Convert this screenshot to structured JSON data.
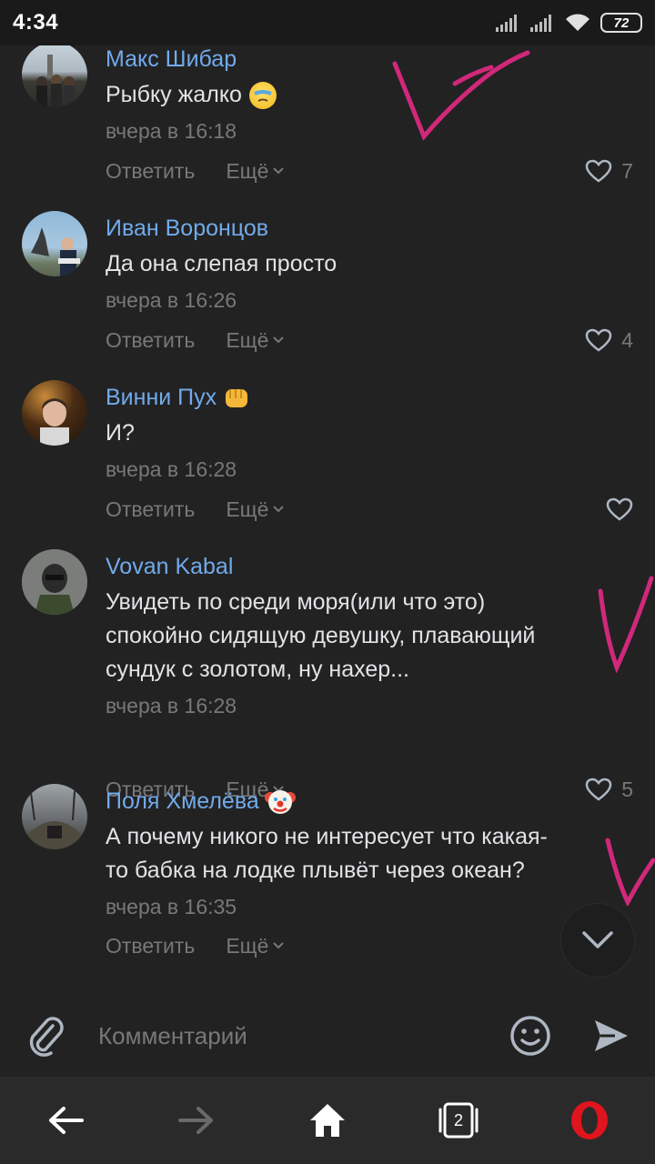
{
  "status": {
    "time": "4:34",
    "battery": "72"
  },
  "comments": [
    {
      "author": "Макс Шибар",
      "text": "Рыбку жалко",
      "time": "вчера в 16:18",
      "reply": "Ответить",
      "more": "Ещё",
      "likes": "7"
    },
    {
      "author": "Иван Воронцов",
      "text": "Да она слепая просто",
      "time": "вчера в 16:26",
      "reply": "Ответить",
      "more": "Ещё",
      "likes": "4"
    },
    {
      "author": "Винни Пух",
      "text": "И?",
      "time": "вчера в 16:28",
      "reply": "Ответить",
      "more": "Ещё",
      "likes": ""
    },
    {
      "author": "Vovan Kabal",
      "text_lines": [
        "Увидеть по среди моря(или что это)",
        "спокойно сидящую девушку, плавающий",
        "сундук с золотом, ну нахер..."
      ],
      "time": "вчера в 16:28",
      "reply": "Ответить",
      "more": "Ещё",
      "likes": "5"
    },
    {
      "author": "Поля Хмелёва",
      "text_lines": [
        "А почему никого не интересует что какая-",
        "то бабка на лодке плывёт через океан?"
      ],
      "time": "вчера в 16:35",
      "reply": "Ответить",
      "more": "Ещё",
      "likes": ""
    }
  ],
  "composer": {
    "placeholder": "Комментарий"
  },
  "nav": {
    "tabs_count": "2"
  },
  "colors": {
    "author": "#71aaeb",
    "muted": "#76787a",
    "annotation": "#d0287a",
    "background": "#222222"
  }
}
